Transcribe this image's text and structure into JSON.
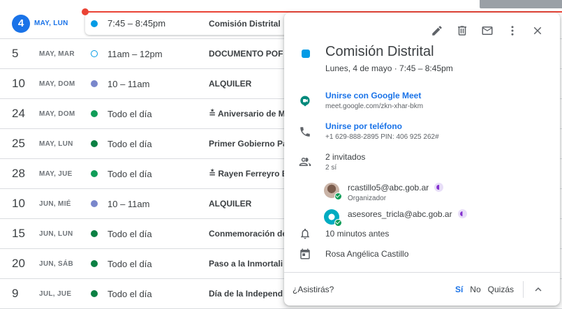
{
  "agenda": [
    {
      "day": "4",
      "dayname": "MAY, LUN",
      "today": true,
      "color": "#039be5",
      "hollow": false,
      "time": "7:45 – 8:45pm",
      "title": "Comisión Distrital"
    },
    {
      "day": "5",
      "dayname": "MAY, MAR",
      "today": false,
      "color": "#039be5",
      "hollow": true,
      "time": "11am – 12pm",
      "title": "DOCUMENTO POF"
    },
    {
      "day": "10",
      "dayname": "MAY, DOM",
      "today": false,
      "color": "#7986cb",
      "hollow": false,
      "time": "10 – 11am",
      "title": "ALQUILER"
    },
    {
      "day": "24",
      "dayname": "MAY, DOM",
      "today": false,
      "color": "#0f9d58",
      "hollow": false,
      "time": "Todo el día",
      "title": "≛ Aniversario de M"
    },
    {
      "day": "25",
      "dayname": "MAY, LUN",
      "today": false,
      "color": "#0b8043",
      "hollow": false,
      "time": "Todo el día",
      "title": "Primer Gobierno Pa"
    },
    {
      "day": "28",
      "dayname": "MAY, JUE",
      "today": false,
      "color": "#0f9d58",
      "hollow": false,
      "time": "Todo el día",
      "title": "≛ Rayen Ferreyro E"
    },
    {
      "day": "10",
      "dayname": "JUN, MIÉ",
      "today": false,
      "color": "#7986cb",
      "hollow": false,
      "time": "10 – 11am",
      "title": "ALQUILER"
    },
    {
      "day": "15",
      "dayname": "JUN, LUN",
      "today": false,
      "color": "#0b8043",
      "hollow": false,
      "time": "Todo el día",
      "title": "Conmemoración de"
    },
    {
      "day": "20",
      "dayname": "JUN, SÁB",
      "today": false,
      "color": "#0b8043",
      "hollow": false,
      "time": "Todo el día",
      "title": "Paso a la Inmortali"
    },
    {
      "day": "9",
      "dayname": "JUL, JUE",
      "today": false,
      "color": "#0b8043",
      "hollow": false,
      "time": "Todo el día",
      "title": "Día de la Independ"
    }
  ],
  "popup": {
    "title": "Comisión Distrital",
    "subtitle": "Lunes, 4 de mayo  ·  7:45 – 8:45pm",
    "meet_label": "Unirse con Google Meet",
    "meet_url": "meet.google.com/zkn-xhar-bkm",
    "phone_label": "Unirse por teléfono",
    "phone_detail": "+1 629-888-2895 PIN: 406 925 262#",
    "guests_count": "2 invitados",
    "guests_yes": "2 sí",
    "guests": [
      {
        "email": "rcastillo5@abc.gob.ar",
        "role": "Organizador"
      },
      {
        "email": "asesores_tricla@abc.gob.ar",
        "role": ""
      }
    ],
    "reminder": "10 minutos antes",
    "calendar_owner": "Rosa Angélica Castillo",
    "rsvp_question": "¿Asistirás?",
    "rsvp_yes": "Sí",
    "rsvp_no": "No",
    "rsvp_maybe": "Quizás"
  },
  "colors": {
    "accent": "#1a73e8",
    "now_line": "#ea4335"
  }
}
